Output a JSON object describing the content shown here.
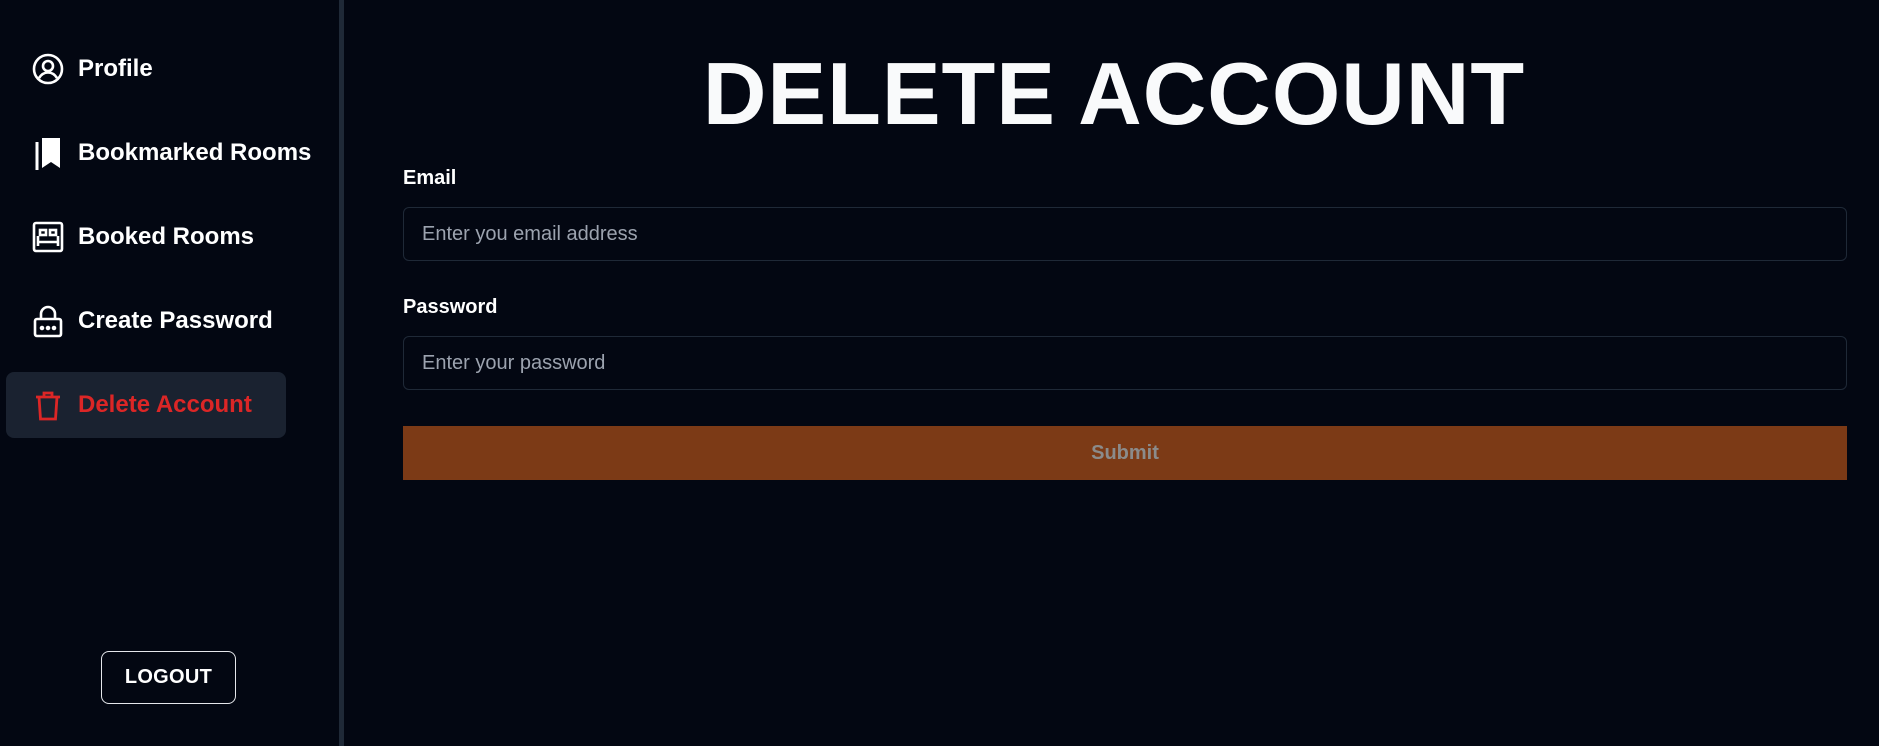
{
  "sidebar": {
    "items": [
      {
        "label": "Profile",
        "icon": "user-circle-icon",
        "active": false
      },
      {
        "label": "Bookmarked Rooms",
        "icon": "bookmarks-icon",
        "active": false
      },
      {
        "label": "Booked Rooms",
        "icon": "bed-icon",
        "active": false
      },
      {
        "label": "Create Password",
        "icon": "lock-icon",
        "active": false
      },
      {
        "label": "Delete Account",
        "icon": "trash-icon",
        "active": true
      }
    ],
    "logout_label": "LOGOUT"
  },
  "main": {
    "title": "DELETE ACCOUNT",
    "email": {
      "label": "Email",
      "placeholder": "Enter you email address",
      "value": ""
    },
    "password": {
      "label": "Password",
      "placeholder": "Enter your password",
      "value": ""
    },
    "submit_label": "Submit"
  },
  "colors": {
    "background": "#030712",
    "active_item_bg": "#1a2230",
    "danger": "#dc2626",
    "submit_bg": "#7c3a16"
  }
}
